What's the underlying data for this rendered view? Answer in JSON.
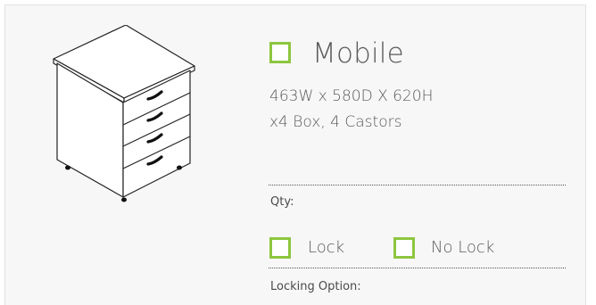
{
  "product": {
    "title": "Mobile",
    "dimensions": "463W x 580D X 620H",
    "description": "x4 Box, 4 Castors",
    "image_name": "mobile-drawer-pedestal-illustration"
  },
  "form": {
    "qty_label": "Qty:",
    "options": [
      {
        "label": "Lock",
        "checked": false
      },
      {
        "label": "No Lock",
        "checked": false
      }
    ],
    "locking_label": "Locking Option:"
  },
  "colors": {
    "checkbox_border": "#8dc63f",
    "panel_background": "#f7f7f7",
    "text": "#5a5a5c"
  }
}
